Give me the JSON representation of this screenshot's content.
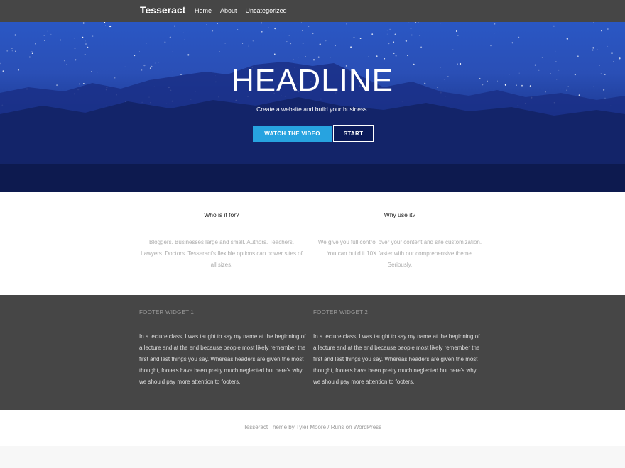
{
  "header": {
    "brand": "Tesseract",
    "nav": [
      "Home",
      "About",
      "Uncategorized"
    ]
  },
  "hero": {
    "headline": "HEADLINE",
    "tagline": "Create a website and build your business.",
    "primary_button": "WATCH THE VIDEO",
    "secondary_button": "START"
  },
  "features": [
    {
      "title": "Who is it for?",
      "text": "Bloggers. Businesses large and small. Authors. Teachers. Lawyers. Doctors. Tesseract's flexible options can power sites of all sizes."
    },
    {
      "title": "Why use it?",
      "text": "We give you full control over your content and site customization. You can build it 10X faster with our comprehensive theme. Seriously."
    }
  ],
  "footer_widgets": [
    {
      "title": "FOOTER WIDGET 1",
      "text": "In a lecture class, I was taught to say my name at the beginning of a lecture and at the end because people most likely remember the first and last things you say. Whereas headers are given the most thought, footers have been pretty much neglected but here's why we should pay more attention to footers."
    },
    {
      "title": "FOOTER WIDGET 2",
      "text": "In a lecture class, I was taught to say my name at the beginning of a lecture and at the end because people most likely remember the first and last things you say. Whereas headers are given the most thought, footers have been pretty much neglected but here's why we should pay more attention to footers."
    }
  ],
  "credits": {
    "theme_link": "Tesseract Theme",
    "by": "by",
    "author_link": "Tyler Moore",
    "separator": "/",
    "runs_on_link": "Runs on WordPress"
  },
  "colors": {
    "topbar": "#464646",
    "accent_button": "#27a3e0",
    "footer_bg": "#464646"
  }
}
